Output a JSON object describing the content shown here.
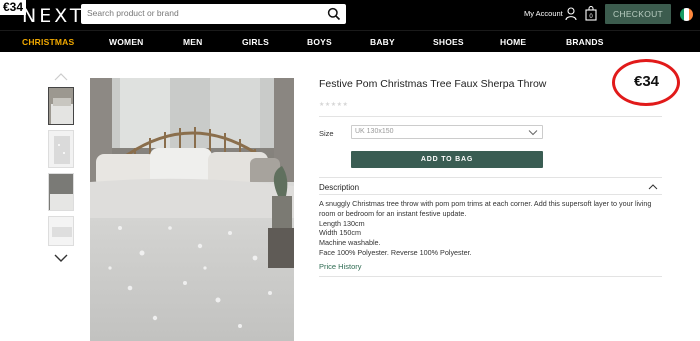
{
  "corner_price": "€34",
  "header": {
    "logo": "NEXT",
    "search_placeholder": "Search product or brand",
    "account_label": "My Account",
    "checkout_label": "CHECKOUT",
    "flag_colors": [
      "#169b62",
      "#ffffff",
      "#ff883e"
    ]
  },
  "nav": {
    "items": [
      "CHRISTMAS",
      "WOMEN",
      "MEN",
      "GIRLS",
      "BOYS",
      "BABY",
      "SHOES",
      "HOME",
      "BRANDS"
    ],
    "active_color": "#f2a900"
  },
  "product": {
    "title": "Festive Pom Christmas Tree Faux Sherpa Throw",
    "stars": "★★★★★",
    "price": "€34",
    "size_label": "Size",
    "size_value": "UK 130x150",
    "add_to_bag_label": "ADD TO BAG",
    "description_heading": "Description",
    "description_lines": [
      "A snuggly Christmas tree throw with pom pom trims at each corner. Add this supersoft layer to your living room or bedroom for an instant festive update.",
      "Length 130cm",
      "Width 150cm",
      "Machine washable.",
      "Face 100% Polyester. Reverse 100% Polyester."
    ],
    "price_history_label": "Price History"
  },
  "colors": {
    "checkout_bg": "#3c5c4e",
    "add_to_bag_bg": "#3a5d53",
    "highlight_ring": "#e11a1a"
  }
}
